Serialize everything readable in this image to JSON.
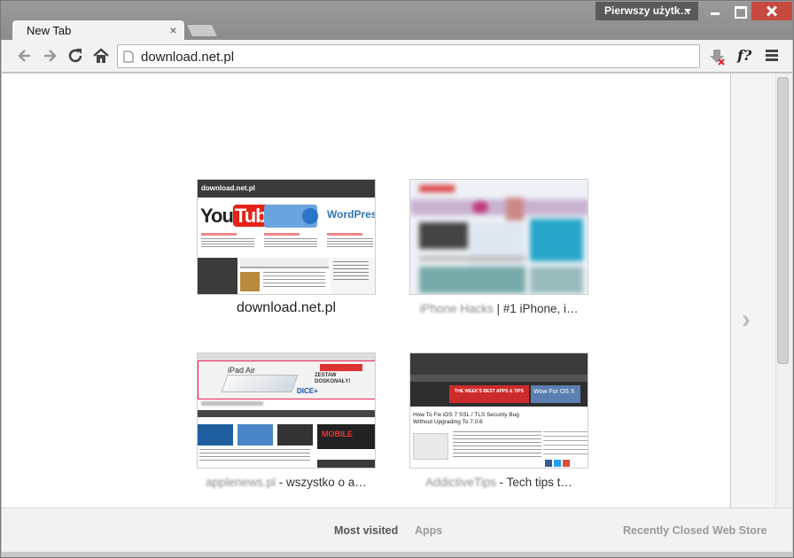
{
  "titlebar": {
    "profile_label": "Pierwszy użytk…"
  },
  "tabs": [
    {
      "title": "New Tab",
      "close": "×"
    }
  ],
  "omnibox": {
    "url": "download.net.pl"
  },
  "toolbar": {
    "extension_f_label": "f?"
  },
  "most_visited": [
    {
      "title_clear": "download.net.pl",
      "title_blurred": ""
    },
    {
      "title_clear": " | #1 iPhone, i…",
      "title_blurred": "iPhone Hacks"
    },
    {
      "title_clear": " - wszystko o a…",
      "title_blurred": "applenews.pl"
    },
    {
      "title_clear": " - Tech tips t…",
      "title_blurred": "AddictiveTips"
    }
  ],
  "thumb_text": {
    "t1_logo": "download.net.pl",
    "t1_youtube": "YouTube",
    "t1_wordpress": "WordPress",
    "t3_ipad": "iPad Air",
    "t3_zestaw": "ZESTAW DOSKONAŁY!",
    "t3_dice": "DICE+",
    "t3_mobile": "MOBILE",
    "t4_headline": "How To Fix iOS 7 SSL / TLS Security Bug Without Upgrading To 7.0.6",
    "t4_banner": "THE WEEK'S BEST APPS & TIPS",
    "t4_wow": "Wow For OS X"
  },
  "footer": {
    "most_visited": "Most visited",
    "apps": "Apps",
    "recently_closed": "Recently Closed",
    "web_store": "Web Store"
  },
  "next_arrow": "›",
  "colors": {
    "close_button": "#c74a3f",
    "profile_bg": "#5a5a5a",
    "youtube_red": "#e62117",
    "addictive_dark": "#3a3a3a"
  }
}
